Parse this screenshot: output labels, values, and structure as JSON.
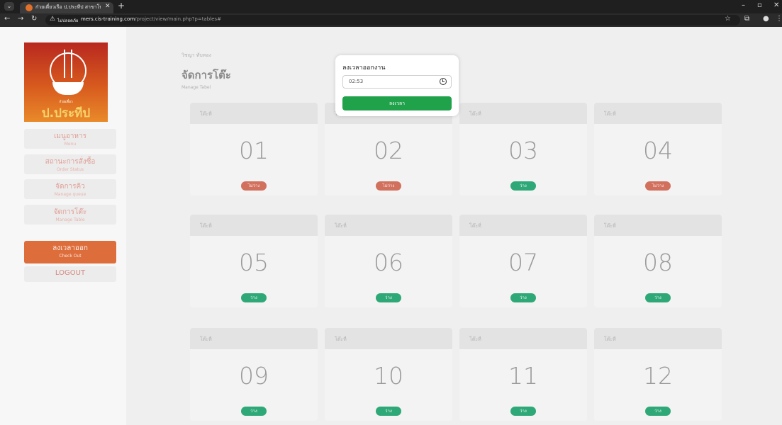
{
  "browser": {
    "tab_title": "ก๋วยเตี๋ยวเรือ ป.ประทีป สาขาโพธิ์ทอง",
    "insecure_label": "ไม่ปลอดภัย",
    "url_domain": "mers.cis-training.com",
    "url_path": "/project/view/main.php?p=tables#"
  },
  "logo": {
    "small_text": "ก๋วยเตี๋ยว",
    "name": "ป.ประทีป"
  },
  "sidebar": {
    "items": [
      {
        "th": "เมนูอาหาร",
        "en": "Menu"
      },
      {
        "th": "สถานะการสั่งซื้อ",
        "en": "Order Status"
      },
      {
        "th": "จัดการคิว",
        "en": "Manage queue"
      },
      {
        "th": "จัดการโต๊ะ",
        "en": "Manage Table"
      },
      {
        "th": "ลงเวลาออก",
        "en": "Check Out"
      },
      {
        "th": "LOGOUT",
        "en": ""
      }
    ]
  },
  "main": {
    "breadcrumb": "วิชญา ทับทอง",
    "title": "จัดการโต๊ะ",
    "subtitle": "Manage Tabel"
  },
  "tables": [
    {
      "label": "โต๊ะที่",
      "number": "01",
      "status": "ไม่ว่าง",
      "state": "busy"
    },
    {
      "label": "โต๊ะที่",
      "number": "02",
      "status": "ไม่ว่าง",
      "state": "busy"
    },
    {
      "label": "โต๊ะที่",
      "number": "03",
      "status": "ว่าง",
      "state": "free"
    },
    {
      "label": "โต๊ะที่",
      "number": "04",
      "status": "ไม่ว่าง",
      "state": "busy"
    },
    {
      "label": "โต๊ะที่",
      "number": "05",
      "status": "ว่าง",
      "state": "free"
    },
    {
      "label": "โต๊ะที่",
      "number": "06",
      "status": "ว่าง",
      "state": "free"
    },
    {
      "label": "โต๊ะที่",
      "number": "07",
      "status": "ว่าง",
      "state": "free"
    },
    {
      "label": "โต๊ะที่",
      "number": "08",
      "status": "ว่าง",
      "state": "free"
    },
    {
      "label": "โต๊ะที่",
      "number": "09",
      "status": "ว่าง",
      "state": "free"
    },
    {
      "label": "โต๊ะที่",
      "number": "10",
      "status": "ว่าง",
      "state": "free"
    },
    {
      "label": "โต๊ะที่",
      "number": "11",
      "status": "ว่าง",
      "state": "free"
    },
    {
      "label": "โต๊ะที่",
      "number": "12",
      "status": "ว่าง",
      "state": "free"
    }
  ],
  "modal": {
    "title": "ลงเวลาออกงาน",
    "time_value": "02:53",
    "button_label": "ลงเวลา"
  },
  "colors": {
    "free_badge": "#2fa878",
    "busy_badge": "#d2705e",
    "modal_button": "#1fa24a",
    "active_menu": "#dd6e3c"
  }
}
